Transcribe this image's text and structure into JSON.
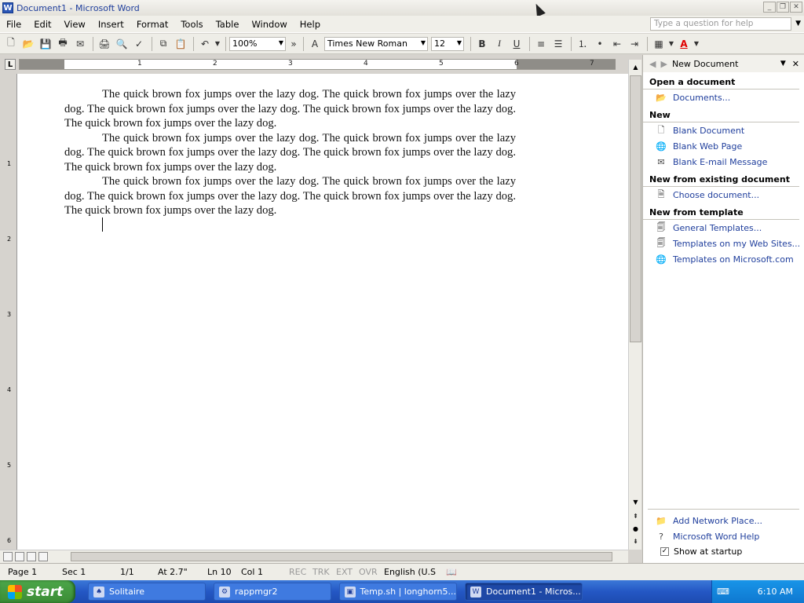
{
  "window": {
    "title": "Document1 - Microsoft Word",
    "app_icon": "W"
  },
  "menubar": {
    "items": [
      "File",
      "Edit",
      "View",
      "Insert",
      "Format",
      "Tools",
      "Table",
      "Window",
      "Help"
    ],
    "help_placeholder": "Type a question for help"
  },
  "toolbar": {
    "zoom": "100%",
    "font": "Times New Roman",
    "size": "12",
    "bold": "B",
    "italic": "I",
    "underline": "U",
    "font_color": "#e00000"
  },
  "ruler": {
    "numbers": [
      "1",
      "2",
      "3",
      "4",
      "5",
      "6",
      "7"
    ]
  },
  "vruler": {
    "numbers": [
      "1",
      "2",
      "3",
      "4",
      "5",
      "6"
    ]
  },
  "document": {
    "paragraphs": [
      "The quick brown fox jumps over the lazy dog.  The quick brown fox jumps over the lazy dog.  The quick brown fox jumps over the lazy dog.  The quick brown fox jumps over the lazy dog.  The quick brown fox jumps over the lazy dog.",
      "The quick brown fox jumps over the lazy dog.  The quick brown fox jumps over the lazy dog.  The quick brown fox jumps over the lazy dog.  The quick brown fox jumps over the lazy dog.  The quick brown fox jumps over the lazy dog.",
      "The quick brown fox jumps over the lazy dog.  The quick brown fox jumps over the lazy dog.  The quick brown fox jumps over the lazy dog.  The quick brown fox jumps over the lazy dog.  The quick brown fox jumps over the lazy dog."
    ]
  },
  "taskpane": {
    "title": "New Document",
    "sections": {
      "open": "Open a document",
      "new": "New",
      "existing": "New from existing document",
      "template": "New from template"
    },
    "links": {
      "documents": "Documents...",
      "blank_document": "Blank Document",
      "blank_web_page": "Blank Web Page",
      "blank_email": "Blank E-mail Message",
      "choose_document": "Choose document...",
      "general_templates": "General Templates...",
      "templates_web": "Templates on my Web Sites...",
      "templates_ms": "Templates on Microsoft.com",
      "add_network": "Add Network Place...",
      "word_help": "Microsoft Word Help"
    },
    "show_at_startup": "Show at startup",
    "show_at_startup_checked": true
  },
  "statusbar": {
    "page": "Page  1",
    "sec": "Sec  1",
    "pages": "1/1",
    "at": "At  2.7\"",
    "ln": "Ln  10",
    "col": "Col  1",
    "rec": "REC",
    "trk": "TRK",
    "ext": "EXT",
    "ovr": "OVR",
    "lang": "English (U.S"
  },
  "taskbar": {
    "start": "start",
    "tasks": [
      "Solitaire",
      "rappmgr2",
      "Temp.sh | longhorn5...",
      "Document1 - Micros..."
    ],
    "clock": "6:10 AM"
  }
}
